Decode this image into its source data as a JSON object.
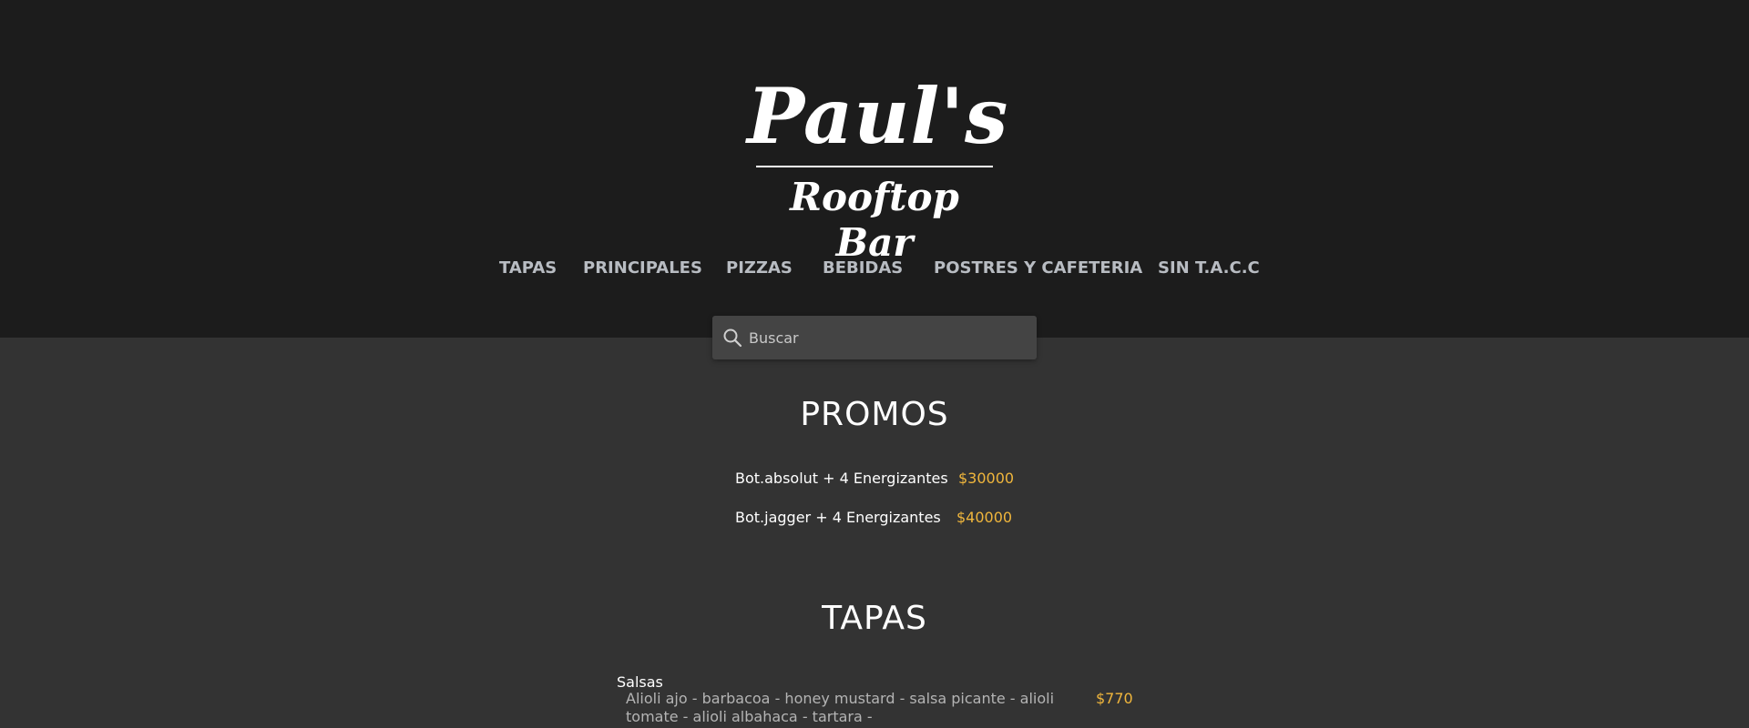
{
  "brand": {
    "name": "Paul's",
    "subtitle": "Rooftop Bar"
  },
  "nav": {
    "items": [
      {
        "label": "TAPAS"
      },
      {
        "label": "PRINCIPALES"
      },
      {
        "label": "PIZZAS"
      },
      {
        "label": "BEBIDAS"
      },
      {
        "label": "POSTRES Y CAFETERIA"
      },
      {
        "label": "SIN T.A.C.C"
      }
    ]
  },
  "search": {
    "placeholder": "Buscar",
    "value": "",
    "icon": "search-icon"
  },
  "promos": {
    "title": "PROMOS",
    "items": [
      {
        "name": "Bot.absolut + 4 Energizantes",
        "price": "$30000"
      },
      {
        "name": "Bot.jagger + 4 Energizantes",
        "price": "$40000"
      }
    ]
  },
  "tapas": {
    "title": "TAPAS",
    "items": [
      {
        "name": "Salsas",
        "description": "Alioli ajo - barbacoa - honey mustard - salsa picante - alioli tomate - alioli albahaca - tartara -",
        "price": "$770"
      }
    ]
  },
  "colors": {
    "header_bg": "#1c1c1c",
    "body_bg": "#333333",
    "nav_text": "#b8bcc2",
    "price_accent": "#f0b63c",
    "search_bg": "#444444"
  }
}
